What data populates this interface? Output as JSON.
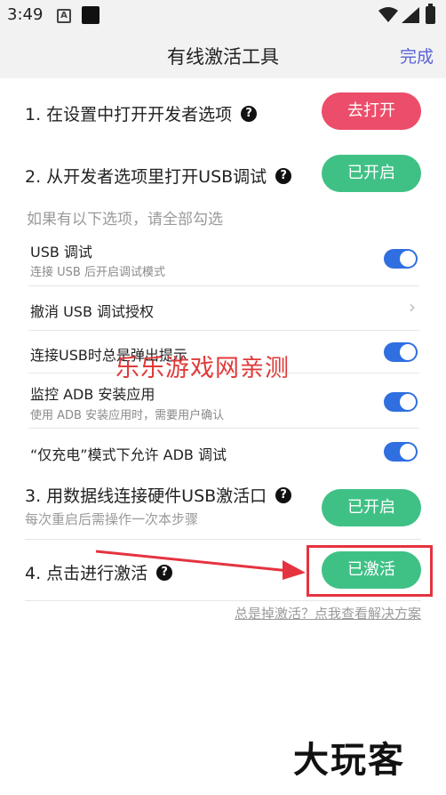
{
  "status": {
    "time": "3:49",
    "a_icon": "A"
  },
  "header": {
    "title": "有线激活工具",
    "done_label": "完成"
  },
  "steps": [
    {
      "label": "1. 在设置中打开开发者选项",
      "button": "去打开",
      "color": "#ec4d6a"
    },
    {
      "label": "2. 从开发者选项里打开USB调试",
      "button": "已开启",
      "color": "#3fc186"
    },
    {
      "label": "3. 用数据线连接硬件USB激活口",
      "sub": "每次重启后需操作一次本步骤",
      "button": "已开启",
      "color": "#3fc186"
    },
    {
      "label": "4. 点击进行激活",
      "button": "已激活",
      "color": "#3fc186"
    }
  ],
  "help_glyph": "?",
  "hint": "如果有以下选项，请全部勾选",
  "options": [
    {
      "title": "USB 调试",
      "sub": "连接 USB 后开启调试模式",
      "control": "toggle",
      "on": true
    },
    {
      "title": "撤消 USB 调试授权",
      "control": "chevron",
      "chevron": "›"
    },
    {
      "title": "连接USB时总是弹出提示",
      "control": "toggle",
      "on": true
    },
    {
      "title": "监控 ADB 安装应用",
      "sub": "使用 ADB 安装应用时，需要用户确认",
      "control": "toggle",
      "on": true
    },
    {
      "title": "“仅充电”模式下允许 ADB 调试",
      "control": "toggle",
      "on": true
    }
  ],
  "watermark": "乐乐游戏网亲测",
  "footer_link": "总是掉激活？点我查看解决方案",
  "logo": "大玩客",
  "colors": {
    "accent": "#5a62d8",
    "toggle": "#2f6fe0",
    "highlight": "#e5333f"
  }
}
